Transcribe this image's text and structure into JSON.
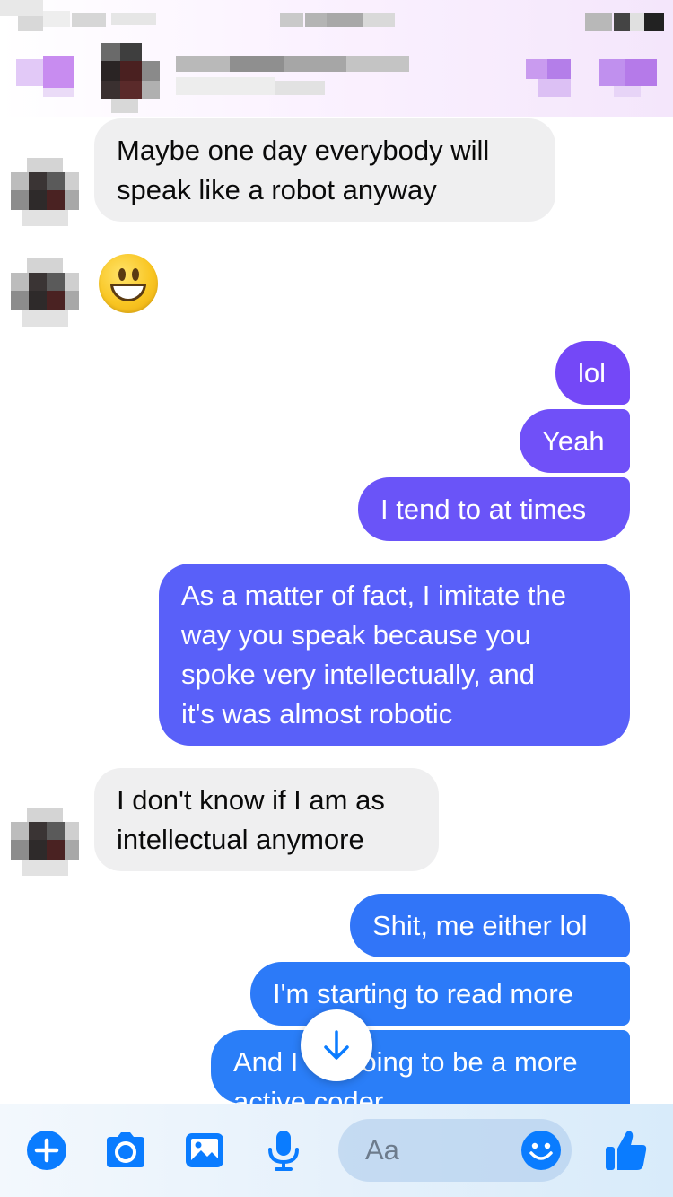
{
  "conversation": {
    "messages": [
      {
        "id": "m1",
        "sender": "contact",
        "lines": [
          "Maybe one day everybody will",
          "speak like a robot anyway"
        ]
      },
      {
        "id": "m2",
        "sender": "contact",
        "emoji": "grinning-face"
      },
      {
        "id": "m3",
        "sender": "me",
        "lines": [
          "lol"
        ]
      },
      {
        "id": "m4",
        "sender": "me",
        "lines": [
          "Yeah"
        ]
      },
      {
        "id": "m5",
        "sender": "me",
        "lines": [
          "I tend to at times"
        ]
      },
      {
        "id": "m6",
        "sender": "me",
        "lines": [
          "As a matter of fact, I imitate the",
          "way you speak because you",
          "spoke very intellectually, and",
          "it's was almost robotic"
        ]
      },
      {
        "id": "m7",
        "sender": "contact",
        "lines": [
          "I don't know if I am as",
          "intellectual anymore"
        ]
      },
      {
        "id": "m8",
        "sender": "me",
        "lines": [
          "Shit, me either lol"
        ]
      },
      {
        "id": "m9",
        "sender": "me",
        "lines": [
          "I'm starting to read more"
        ]
      },
      {
        "id": "m10",
        "sender": "me",
        "lines": [
          "And I",
          "oing to be a more",
          "active coder"
        ]
      }
    ]
  },
  "composer": {
    "placeholder": "Aa",
    "icons": [
      "plus-icon",
      "camera-icon",
      "photo-icon",
      "microphone-icon",
      "emoji-icon",
      "thumbs-up-icon"
    ]
  },
  "colors": {
    "accent": "#0a7cff",
    "bubble_purple": "#7448f7",
    "bubble_indigo": "#5960f9",
    "bubble_blue": "#2c7cf8",
    "bubble_incoming": "#efeff0"
  }
}
